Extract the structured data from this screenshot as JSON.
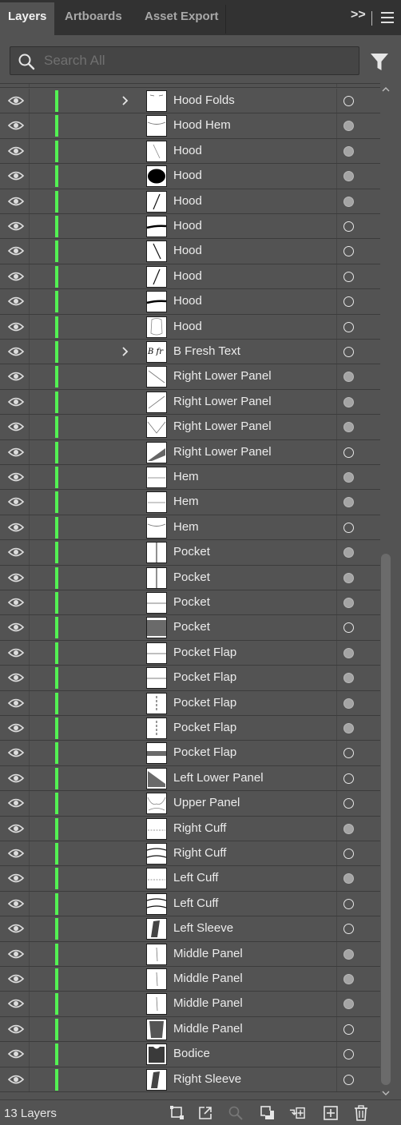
{
  "tabs": [
    {
      "label": "Layers",
      "active": true
    },
    {
      "label": "Artboards",
      "active": false
    },
    {
      "label": "Asset Export",
      "active": false
    }
  ],
  "panel_controls": {
    "collapse": ">>",
    "menu_icon": "hamburger-icon"
  },
  "search": {
    "placeholder": "Search All",
    "value": "",
    "icon": "search-icon"
  },
  "filter_icon": "funnel-icon",
  "layer_color": "#53f253",
  "rows": [
    {
      "label": "Hood Folds",
      "expandable": true,
      "selected": false,
      "thumb": "folds"
    },
    {
      "label": "Hood Hem",
      "expandable": false,
      "selected": true,
      "thumb": "curve-top"
    },
    {
      "label": "Hood",
      "expandable": false,
      "selected": true,
      "thumb": "diag-thin"
    },
    {
      "label": "Hood",
      "expandable": false,
      "selected": true,
      "thumb": "black-oval"
    },
    {
      "label": "Hood",
      "expandable": false,
      "selected": true,
      "thumb": "diag-line"
    },
    {
      "label": "Hood",
      "expandable": false,
      "selected": false,
      "thumb": "thick-curve"
    },
    {
      "label": "Hood",
      "expandable": false,
      "selected": false,
      "thumb": "diag-line2"
    },
    {
      "label": "Hood",
      "expandable": false,
      "selected": false,
      "thumb": "diag-line"
    },
    {
      "label": "Hood",
      "expandable": false,
      "selected": false,
      "thumb": "thick-curve"
    },
    {
      "label": "Hood",
      "expandable": false,
      "selected": false,
      "thumb": "hood-outline"
    },
    {
      "label": "B Fresh Text",
      "expandable": true,
      "selected": false,
      "thumb": "script-text"
    },
    {
      "label": "Right Lower Panel",
      "expandable": false,
      "selected": true,
      "thumb": "diag-down"
    },
    {
      "label": "Right Lower Panel",
      "expandable": false,
      "selected": true,
      "thumb": "diag-up"
    },
    {
      "label": "Right Lower Panel",
      "expandable": false,
      "selected": true,
      "thumb": "v-lines"
    },
    {
      "label": "Right Lower Panel",
      "expandable": false,
      "selected": false,
      "thumb": "gray-wedge"
    },
    {
      "label": "Hem",
      "expandable": false,
      "selected": true,
      "thumb": "h-line"
    },
    {
      "label": "Hem",
      "expandable": false,
      "selected": true,
      "thumb": "h-line"
    },
    {
      "label": "Hem",
      "expandable": false,
      "selected": false,
      "thumb": "curve-top"
    },
    {
      "label": "Pocket",
      "expandable": false,
      "selected": true,
      "thumb": "v-center"
    },
    {
      "label": "Pocket",
      "expandable": false,
      "selected": true,
      "thumb": "v-center"
    },
    {
      "label": "Pocket",
      "expandable": false,
      "selected": true,
      "thumb": "h-mid"
    },
    {
      "label": "Pocket",
      "expandable": false,
      "selected": false,
      "thumb": "gray-block"
    },
    {
      "label": "Pocket Flap",
      "expandable": false,
      "selected": true,
      "thumb": "h-mid"
    },
    {
      "label": "Pocket Flap",
      "expandable": false,
      "selected": true,
      "thumb": "h-mid"
    },
    {
      "label": "Pocket Flap",
      "expandable": false,
      "selected": true,
      "thumb": "v-dash"
    },
    {
      "label": "Pocket Flap",
      "expandable": false,
      "selected": true,
      "thumb": "v-dash"
    },
    {
      "label": "Pocket Flap",
      "expandable": false,
      "selected": false,
      "thumb": "gray-band"
    },
    {
      "label": "Left Lower Panel",
      "expandable": false,
      "selected": false,
      "thumb": "gray-tri"
    },
    {
      "label": "Upper Panel",
      "expandable": false,
      "selected": false,
      "thumb": "upper-outline"
    },
    {
      "label": "Right Cuff",
      "expandable": false,
      "selected": true,
      "thumb": "dash-h"
    },
    {
      "label": "Right Cuff",
      "expandable": false,
      "selected": false,
      "thumb": "cuff"
    },
    {
      "label": "Left Cuff",
      "expandable": false,
      "selected": true,
      "thumb": "dash-h"
    },
    {
      "label": "Left Cuff",
      "expandable": false,
      "selected": false,
      "thumb": "cuff"
    },
    {
      "label": "Left Sleeve",
      "expandable": false,
      "selected": false,
      "thumb": "sleeve"
    },
    {
      "label": "Middle Panel",
      "expandable": false,
      "selected": true,
      "thumb": "v-thin"
    },
    {
      "label": "Middle Panel",
      "expandable": false,
      "selected": true,
      "thumb": "v-thin"
    },
    {
      "label": "Middle Panel",
      "expandable": false,
      "selected": true,
      "thumb": "v-thin"
    },
    {
      "label": "Middle Panel",
      "expandable": false,
      "selected": false,
      "thumb": "middle-shape"
    },
    {
      "label": "Bodice",
      "expandable": false,
      "selected": false,
      "thumb": "bodice"
    },
    {
      "label": "Right Sleeve",
      "expandable": false,
      "selected": false,
      "thumb": "sleeve"
    }
  ],
  "footer": {
    "layer_count": "13 Layers",
    "icons": [
      "collect-for-export-icon",
      "export-selection-icon",
      "locate-object-icon",
      "make-clipping-mask-icon",
      "create-sublayer-icon",
      "new-layer-icon",
      "trash-icon"
    ]
  }
}
